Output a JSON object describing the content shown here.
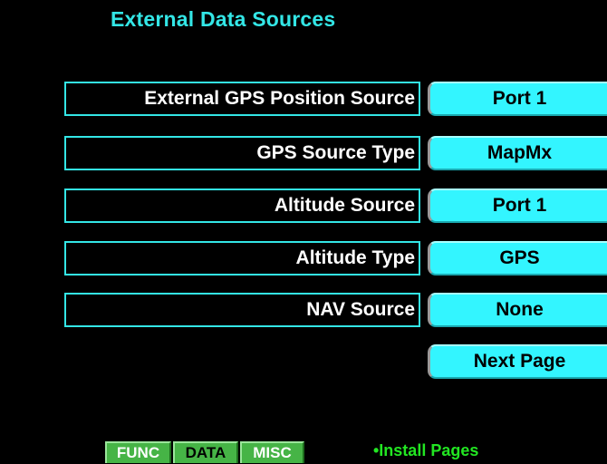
{
  "header": {
    "title": "External Data Sources"
  },
  "rows": [
    {
      "label": "External GPS Position Source",
      "value": "Port 1"
    },
    {
      "label": "GPS Source Type",
      "value": "MapMx"
    },
    {
      "label": "Altitude Source",
      "value": "Port 1"
    },
    {
      "label": "Altitude Type",
      "value": "GPS"
    },
    {
      "label": "NAV Source",
      "value": "None"
    }
  ],
  "next_page_label": "Next Page",
  "tabs": [
    {
      "label": "FUNC",
      "active": false
    },
    {
      "label": "DATA",
      "active": true
    },
    {
      "label": "MISC",
      "active": false
    }
  ],
  "footer": {
    "install_pages": "•Install Pages"
  },
  "colors": {
    "background": "#000000",
    "title": "#33e6e6",
    "label_border": "#33e6e6",
    "button_fill": "#33f5ff",
    "tab_fill": "#46b446",
    "footer_text": "#22e622"
  }
}
